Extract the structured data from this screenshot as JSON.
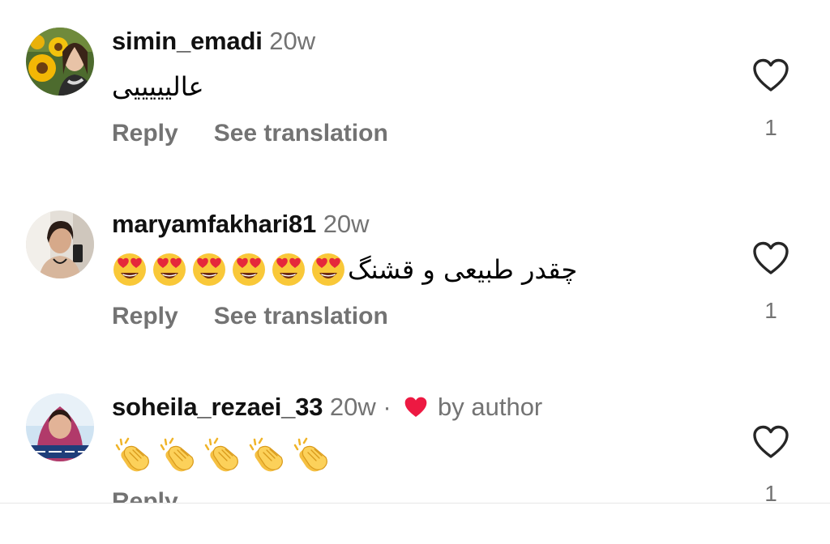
{
  "comments": [
    {
      "username": "simin_emadi",
      "time": "20w",
      "text": "عالیییییی",
      "emoji_count": 0,
      "emoji": "",
      "reply_label": "Reply",
      "translate_label": "See translation",
      "likes": "1",
      "liked_by_author": false
    },
    {
      "username": "maryamfakhari81",
      "time": "20w",
      "text": "چقدر طبیعی و قشنگ",
      "emoji_count": 6,
      "emoji": "heart-eyes-emoji",
      "reply_label": "Reply",
      "translate_label": "See translation",
      "likes": "1",
      "liked_by_author": false
    },
    {
      "username": "soheila_rezaei_33",
      "time": "20w",
      "separator": "·",
      "author_label": "by author",
      "text": "",
      "emoji_count": 5,
      "emoji": "clapping-hands-emoji",
      "reply_label": "Reply",
      "likes": "1",
      "liked_by_author": true
    }
  ],
  "icons": {
    "like": "heart-outline-icon",
    "author_like": "heart-filled-icon"
  },
  "colors": {
    "muted_text": "#737373",
    "author_heart": "#ed1942",
    "emoji_face": "#f9c838"
  }
}
